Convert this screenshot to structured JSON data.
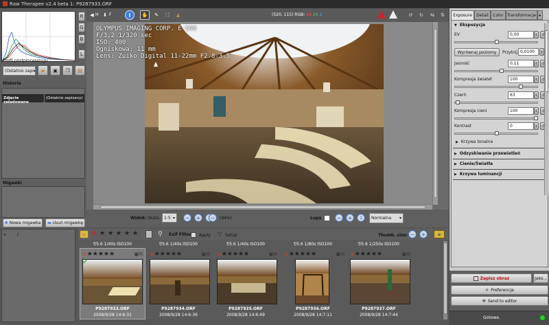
{
  "window": {
    "title": "Raw Therapee v2.4 beta 1: P9287933.ORF"
  },
  "left": {
    "histogram_channels": [
      "R",
      "G",
      "B",
      "L"
    ],
    "profile_label": "Profil postprocessingu",
    "profile_value": "(Ostatnio zapi",
    "history_title": "Historia",
    "history_rows": [
      {
        "action": "Zdjęcie załadowane",
        "value": "(Ostatnio zapisany)"
      }
    ],
    "snapshots_title": "Migawki",
    "new_snapshot": "Nowa migawka",
    "delete_snapshot": "Usuń migawkę"
  },
  "toolbar": {
    "h_label": "H",
    "f_label": "F",
    "coords": "(520, 115) RGB:",
    "rgb_r": "44",
    "rgb_g": "24",
    "rgb_b": "2"
  },
  "overlay": {
    "lines": [
      "OLYMPUS IMAGING CORP.   E-500",
      "F/3,2 1/320 sec",
      "ISO: 400",
      "Ogniskowa: 11 mm",
      "Lens: Zuiko Digital 11-22mm F2.8-3.5"
    ]
  },
  "view": {
    "view_label": "Widok:",
    "scale_label": "Skala:",
    "scale_value": "1:5",
    "zoom_pct": "(94%)",
    "lupa_label": "Lupa",
    "mode_value": "Normalna"
  },
  "right": {
    "tabs": [
      "Exposure",
      "Detail",
      "Color",
      "Transformacje"
    ],
    "section_title": "Ekspozycja",
    "ev_label": "EV",
    "ev_value": "0,00",
    "auto_button": "Wyrównaj poziomy",
    "clip_label": "Przytnij",
    "clip_value": "0,0100",
    "brightness_label": "Jasność",
    "brightness_value": "0,11",
    "hl_comp_label": "Kompresja świateł",
    "hl_comp_value": "100",
    "black_label": "Czerń",
    "black_value": "63",
    "sh_comp_label": "Kompresja cieni",
    "sh_comp_value": "100",
    "contrast_label": "Kontrast",
    "contrast_value": "0",
    "tone_curve": "Krzywa tonalna",
    "collapsed": [
      "Odzyskiwanie przewietleń",
      "Cienie/Światła",
      "Krzywa luminancji"
    ]
  },
  "filmstrip": {
    "path": "/",
    "exif_label": "Exif Filter:",
    "apply_label": "Apply",
    "setup_label": "Setup",
    "thumb_size_label": "Thumb. size:",
    "thumbs": [
      {
        "info": "f/5.6 1/40s ISO100",
        "name": "P9287933.ORF",
        "date": "2008/9/28 14:6:31"
      },
      {
        "info": "f/5.6 1/40s ISO100",
        "name": "P9287934.ORF",
        "date": "2008/9/28 14:6:36"
      },
      {
        "info": "f/5.6 1/40s ISO100",
        "name": "P9287935.ORF",
        "date": "2008/9/28 14:6:49"
      },
      {
        "info": "f/5.6 1/80s ISO100",
        "name": "P9287936.ORF",
        "date": "2008/9/28 14:7:11"
      },
      {
        "info": "f/5.6 1/250s ISO100",
        "name": "P9287937.ORF",
        "date": "2008/9/28 14:7:44"
      }
    ]
  },
  "bottom_right": {
    "save_label": "Zapisz obraz",
    "jako_label": "Jako...",
    "prefs_label": "Preferencje",
    "send_label": "Send to editor",
    "status": "Gotowe."
  }
}
